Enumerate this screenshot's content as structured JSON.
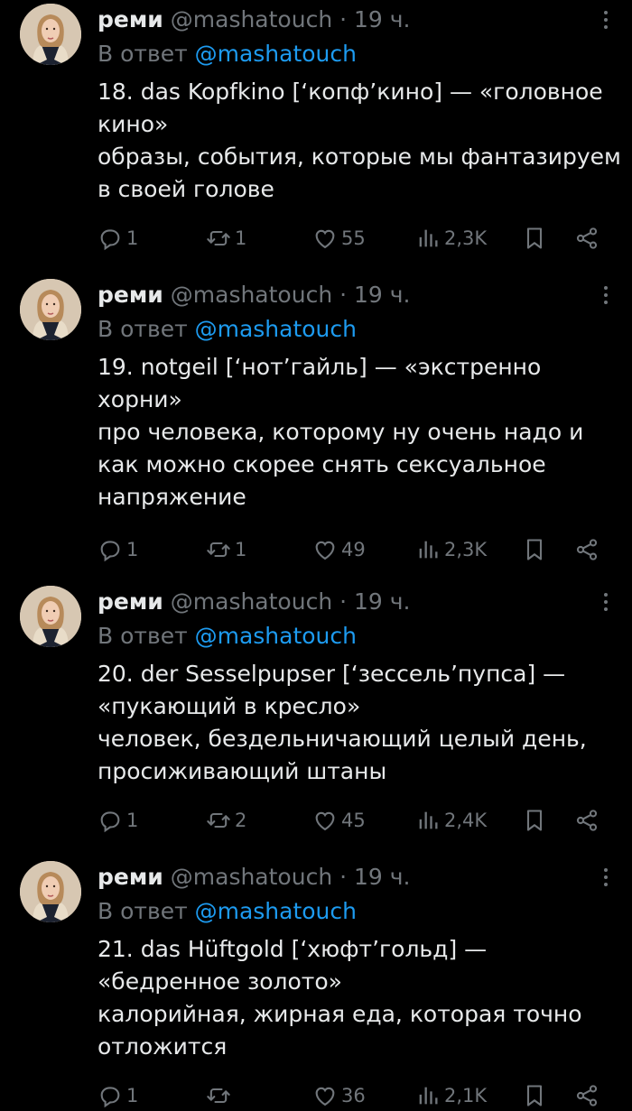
{
  "tweets": [
    {
      "name": "реми",
      "handle": "@mashatouch",
      "time": "· 19 ч.",
      "reply_prefix": "В ответ",
      "reply_handle": "@mashatouch",
      "lines": [
        "18. das Kopfkino [‘копф’кино] — «головное",
        "кино»",
        "образы, события, которые мы фантазируем",
        "в своей голове"
      ],
      "replies": "1",
      "retweets": "1",
      "likes": "55",
      "views": "2,3K"
    },
    {
      "name": "реми",
      "handle": "@mashatouch",
      "time": "· 19 ч.",
      "reply_prefix": "В ответ",
      "reply_handle": "@mashatouch",
      "lines": [
        "19. notgeil [‘нот’гайль] — «экстренно",
        "хорни»",
        "про человека, которому ну очень надо и",
        "как можно скорее снять сексуальное",
        "напряжение"
      ],
      "replies": "1",
      "retweets": "1",
      "likes": "49",
      "views": "2,3K"
    },
    {
      "name": "реми",
      "handle": "@mashatouch",
      "time": "· 19 ч.",
      "reply_prefix": "В ответ",
      "reply_handle": "@mashatouch",
      "lines": [
        "20. der Sesselpupser [‘зессель’пупса] —",
        "«пукающий в кресло»",
        "человек, бездельничающий целый день,",
        "просиживающий штаны"
      ],
      "replies": "1",
      "retweets": "2",
      "likes": "45",
      "views": "2,4K"
    },
    {
      "name": "реми",
      "handle": "@mashatouch",
      "time": "· 19 ч.",
      "reply_prefix": "В ответ",
      "reply_handle": "@mashatouch",
      "lines": [
        "21. das Hüftgold [‘хюфт’гольд] —",
        "«бедренное золото»",
        "калорийная, жирная еда, которая точно",
        "отложится"
      ],
      "replies": "1",
      "retweets": "",
      "likes": "36",
      "views": "2,1K"
    }
  ],
  "icons": {
    "reply": "reply-icon",
    "retweet": "retweet-icon",
    "like": "heart-icon",
    "views": "views-icon",
    "bookmark": "bookmark-icon",
    "share": "share-icon",
    "more": "more-icon"
  },
  "colors": {
    "background": "#000000",
    "text": "#e7e9ea",
    "muted": "#71767b",
    "link": "#1d9bf0"
  }
}
